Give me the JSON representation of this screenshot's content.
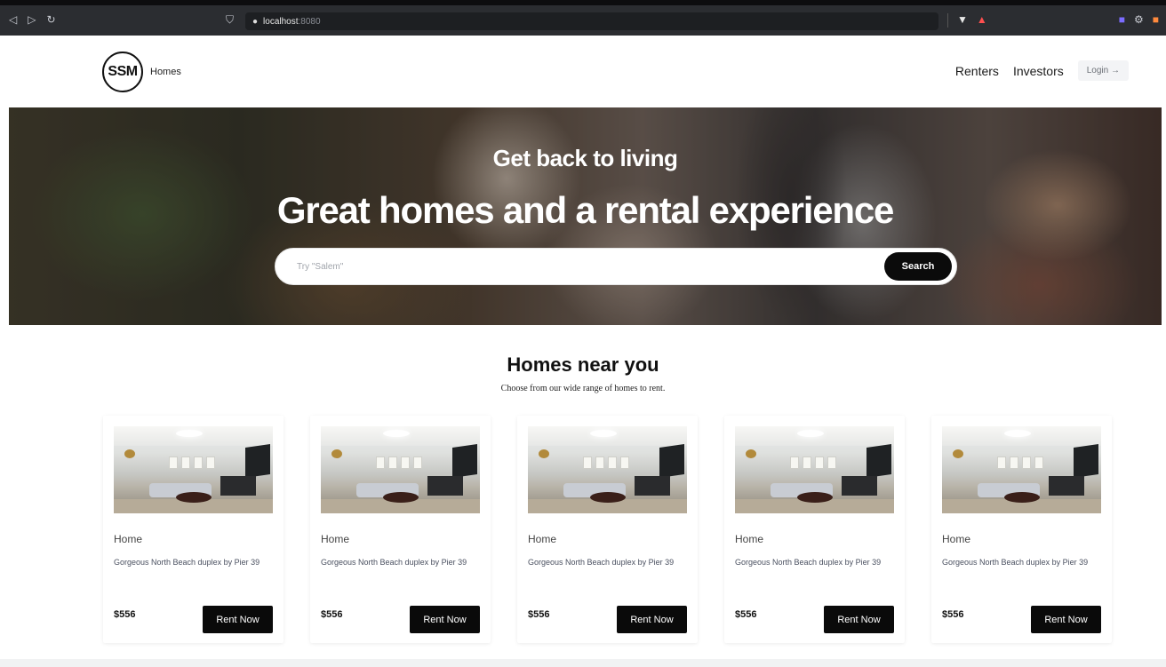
{
  "browser": {
    "url_host": "localhost",
    "url_port": ":8080",
    "nav_icons": [
      "back-icon",
      "forward-icon",
      "reload-icon"
    ],
    "extension_icons": [
      "brave-shield-icon",
      "brave-rewards-icon"
    ],
    "right_icons": [
      "extension-icon",
      "settings-icon",
      "profile-icon"
    ]
  },
  "header": {
    "logo_text": "SSM",
    "brand_name": "Homes",
    "nav": {
      "renters": "Renters",
      "investors": "Investors",
      "login": "Login →"
    }
  },
  "hero": {
    "subtitle": "Get back to living",
    "title": "Great homes and a rental experience",
    "search_placeholder": "Try \"Salem\"",
    "search_button": "Search"
  },
  "section": {
    "title": "Homes near you",
    "subtitle": "Choose from our wide range of homes to rent."
  },
  "cards": [
    {
      "category": "Home",
      "description": "Gorgeous North Beach duplex by Pier 39",
      "price": "$556",
      "button": "Rent Now"
    },
    {
      "category": "Home",
      "description": "Gorgeous North Beach duplex by Pier 39",
      "price": "$556",
      "button": "Rent Now"
    },
    {
      "category": "Home",
      "description": "Gorgeous North Beach duplex by Pier 39",
      "price": "$556",
      "button": "Rent Now"
    },
    {
      "category": "Home",
      "description": "Gorgeous North Beach duplex by Pier 39",
      "price": "$556",
      "button": "Rent Now"
    },
    {
      "category": "Home",
      "description": "Gorgeous North Beach duplex by Pier 39",
      "price": "$556",
      "button": "Rent Now"
    }
  ],
  "colors": {
    "accent": "#0a0a0a",
    "hero_text": "#ffffff",
    "login_bg": "#f3f4f6"
  }
}
